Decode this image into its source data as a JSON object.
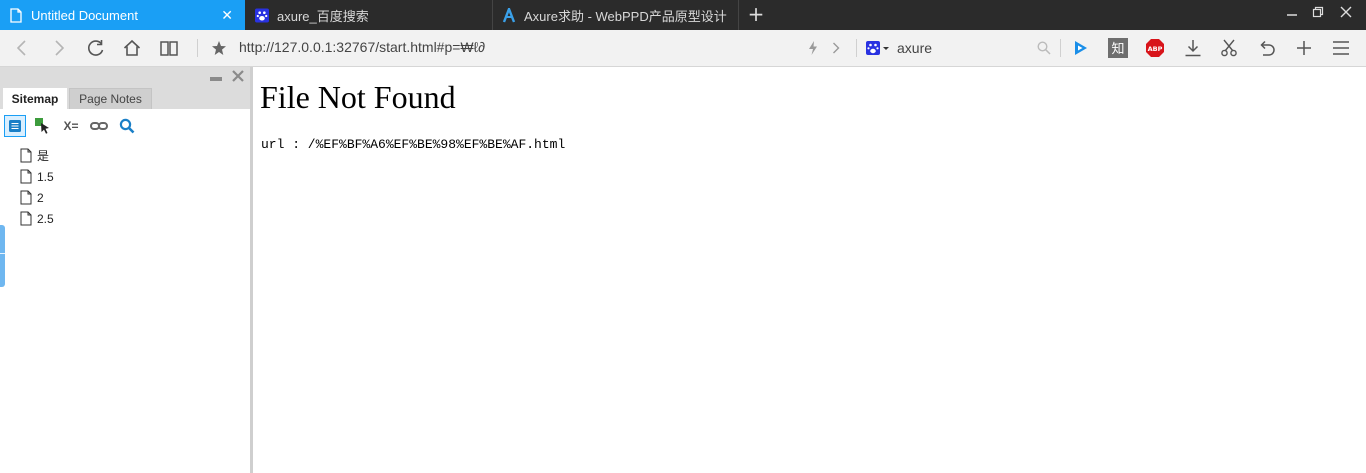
{
  "tabs": [
    {
      "title": "Untitled Document",
      "active": true
    },
    {
      "title": "axure_百度搜索",
      "active": false
    },
    {
      "title": "Axure求助 - WebPPD产品原型设计",
      "active": false
    }
  ],
  "address_bar": {
    "url": "http://127.0.0.1:32767/start.html#p=₩ℓ∂",
    "search_text": "axure"
  },
  "toolbar": {
    "zhi_label": "知",
    "abp_label": "ABP"
  },
  "sidebar": {
    "tabs": [
      "Sitemap",
      "Page Notes"
    ],
    "variables_label": "X=",
    "pages": [
      "是",
      "1.5",
      "2",
      "2.5"
    ]
  },
  "content": {
    "heading": "File Not Found",
    "url_line": "url : /%EF%BF%A6%EF%BE%98%EF%BE%AF.html"
  },
  "colors": {
    "active_tab": "#1a9ff5",
    "tabbar_bg": "#2b2b2b",
    "navbar_bg": "#f2f2f2"
  }
}
